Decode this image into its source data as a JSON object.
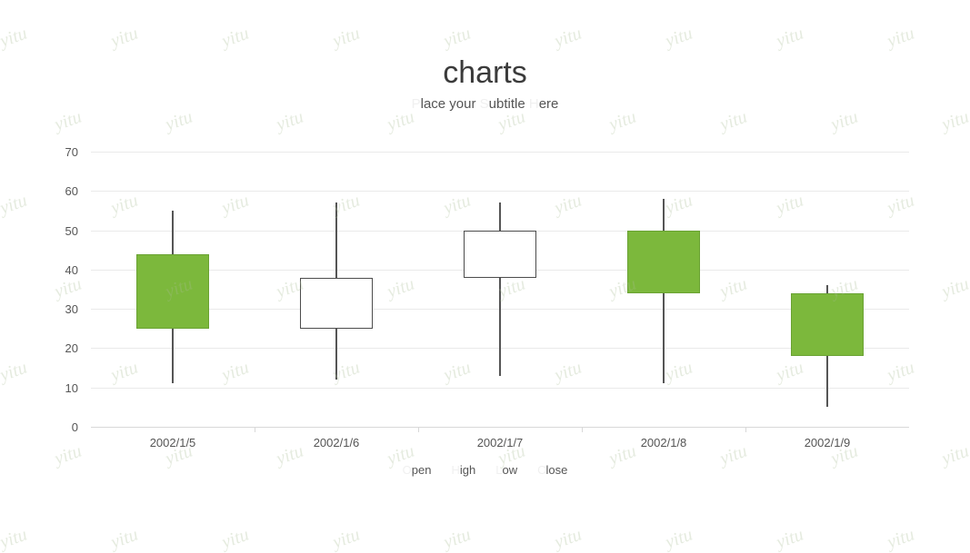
{
  "title": "charts",
  "subtitle": {
    "full": "Place your Subtitle Here",
    "p1_faded": "P",
    "p1_rest": "lace your ",
    "p2_faded": "S",
    "p2_rest": "ubtitle ",
    "p3_faded": "H",
    "p3_rest": "ere"
  },
  "watermark_text": "yitu",
  "legend": {
    "items": [
      {
        "faded": "O",
        "rest": "pen",
        "full": "Open"
      },
      {
        "faded": "H",
        "rest": "igh",
        "full": "High"
      },
      {
        "faded": "L",
        "rest": "ow",
        "full": "Low"
      },
      {
        "faded": "C",
        "rest": "lose",
        "full": "Close"
      }
    ]
  },
  "axes": {
    "y_ticks": [
      "70",
      "60",
      "50",
      "40",
      "30",
      "20",
      "10",
      "0"
    ],
    "x_ticks": [
      "2002/1/5",
      "2002/1/6",
      "2002/1/7",
      "2002/1/8",
      "2002/1/9"
    ]
  },
  "colors": {
    "up": "#7cb83c",
    "down": "#ffffff",
    "border": "#555555",
    "grid": "#eaeaea",
    "text": "#555555"
  },
  "chart_data": {
    "type": "candlestick",
    "title": "charts",
    "subtitle": "Place your Subtitle Here",
    "xlabel": "",
    "ylabel": "",
    "ylim": [
      0,
      70
    ],
    "ytick_step": 10,
    "grid": true,
    "legend_position": "bottom",
    "legend": [
      "Open",
      "High",
      "Low",
      "Close"
    ],
    "categories": [
      "2002/1/5",
      "2002/1/6",
      "2002/1/7",
      "2002/1/8",
      "2002/1/9"
    ],
    "series": [
      {
        "name": "Open",
        "values": [
          25,
          38,
          50,
          34,
          34
        ]
      },
      {
        "name": "Close",
        "values": [
          44,
          25,
          38,
          50,
          18
        ]
      },
      {
        "name": "High",
        "values": [
          55,
          57,
          57,
          58,
          36
        ]
      },
      {
        "name": "Low",
        "values": [
          11,
          12,
          13,
          11,
          5
        ]
      }
    ],
    "points": [
      {
        "x": "2002/1/5",
        "open": 25,
        "close": 44,
        "high": 55,
        "low": 11,
        "direction": "up"
      },
      {
        "x": "2002/1/6",
        "open": 38,
        "close": 25,
        "high": 57,
        "low": 12,
        "direction": "down"
      },
      {
        "x": "2002/1/7",
        "open": 50,
        "close": 38,
        "high": 57,
        "low": 13,
        "direction": "down"
      },
      {
        "x": "2002/1/8",
        "open": 34,
        "close": 50,
        "high": 58,
        "low": 11,
        "direction": "up"
      },
      {
        "x": "2002/1/9",
        "open": 34,
        "close": 18,
        "high": 36,
        "low": 5,
        "direction": "up"
      }
    ]
  }
}
